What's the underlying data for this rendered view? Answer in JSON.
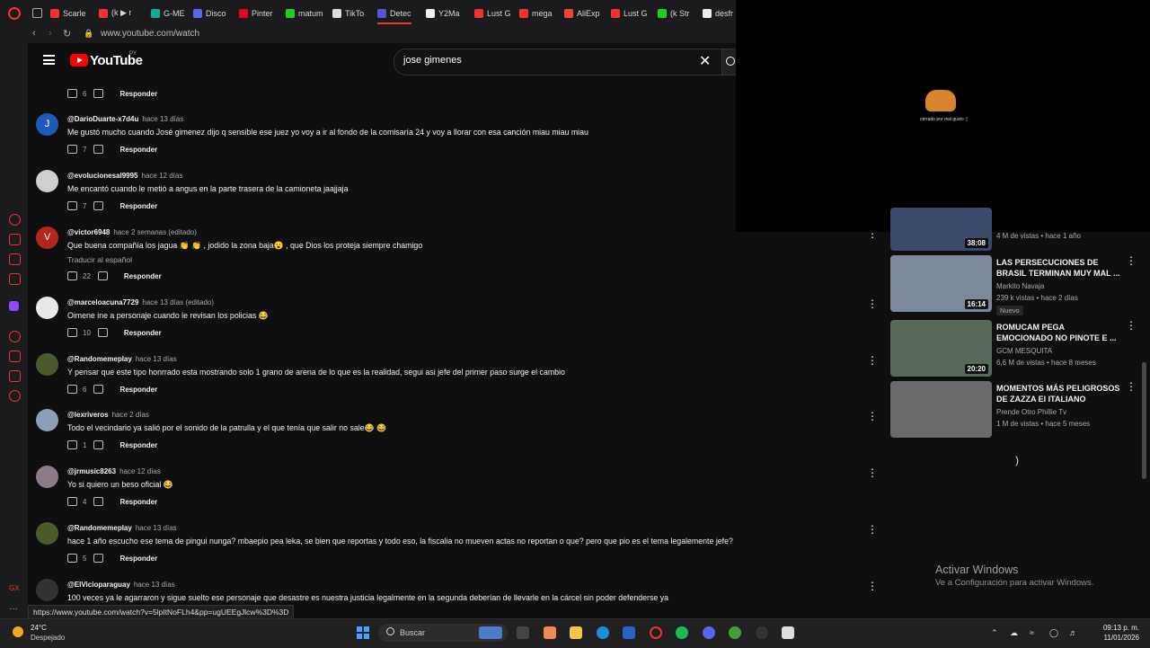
{
  "browser": {
    "tabs": [
      {
        "label": "Scarle",
        "color": "#e33"
      },
      {
        "label": "(k ▶ r",
        "color": "#e33"
      },
      {
        "label": "G-ME",
        "color": "#1a9"
      },
      {
        "label": "Disco",
        "color": "#5865f2"
      },
      {
        "label": "Pinter",
        "color": "#e60023"
      },
      {
        "label": "matum",
        "color": "#2c2"
      },
      {
        "label": "TikTo",
        "color": "#ddd"
      },
      {
        "label": "Detec",
        "color": "#55c"
      },
      {
        "label": "Y2Ma",
        "color": "#eee"
      },
      {
        "label": "Lust G",
        "color": "#e33"
      },
      {
        "label": "mega",
        "color": "#e33"
      },
      {
        "label": "AliExp",
        "color": "#e43"
      },
      {
        "label": "Lust G",
        "color": "#e33"
      },
      {
        "label": "(k Str",
        "color": "#2c2"
      },
      {
        "label": "desfr",
        "color": "#eee"
      }
    ],
    "url": "www.youtube.com/watch",
    "status_url": "https://www.youtube.com/watch?v=5lpItNoFLh4&pp=ugUEEgJlcw%3D%3D"
  },
  "header": {
    "logo_text": "YouTube",
    "region": "PY",
    "search_value": "jose gimenes"
  },
  "comments": [
    {
      "handle": "",
      "time": "",
      "text": "",
      "likes": "6",
      "reply": "Responder",
      "avatar_color": "#555",
      "avatar_letter": ""
    },
    {
      "handle": "@DarioDuarte-x7d4u",
      "time": "hace 13 días",
      "text": "Me gustó mucho cuando José gimenez dijo q sensible ese juez yo voy a ir al fondo de la comisaría 24 y voy a llorar con esa canción miau miau miau",
      "likes": "7",
      "reply": "Responder",
      "avatar_color": "#1e5bb8",
      "avatar_letter": "J"
    },
    {
      "handle": "@evolucionesal9995",
      "time": "hace 12 días",
      "text": "Me encantó cuando le metió a angus en la parte trasera de la camioneta jaajjaja",
      "likes": "7",
      "reply": "Responder",
      "avatar_color": "#cfcfcf",
      "avatar_letter": ""
    },
    {
      "handle": "@victor6948",
      "time": "hace 2 semanas (editado)",
      "text": "Que buena compañía los jagua 👏 👏 , jodido la zona baja😮 , que Dios los proteja siempre chamigo",
      "translate": "Traducir al español",
      "likes": "22",
      "reply": "Responder",
      "avatar_color": "#b3261e",
      "avatar_letter": "V"
    },
    {
      "handle": "@marceloacuna7729",
      "time": "hace 13 días (editado)",
      "text": "Oimene ine a personaje cuando le revisan los policias 😂",
      "likes": "10",
      "reply": "Responder",
      "avatar_color": "#e8e8e8",
      "avatar_letter": ""
    },
    {
      "handle": "@Randomemeplay",
      "time": "hace 13 días",
      "text": "Y pensar que este tipo honrrado esta mostrando solo 1 grano de arena de lo que es la realidad, segui asi jefe del primer paso surge el cambio",
      "likes": "6",
      "reply": "Responder",
      "avatar_color": "#4a5a2a",
      "avatar_letter": ""
    },
    {
      "handle": "@lexriveros",
      "time": "hace 2 días",
      "text": "Todo el vecindario ya salió por el sonido de la patrulla y el que tenía que salir no sale😂 😂",
      "likes": "1",
      "reply": "Responder",
      "avatar_color": "#8aa0b8",
      "avatar_letter": ""
    },
    {
      "handle": "@jrmusic8263",
      "time": "hace 12 días",
      "text": "Yo si quiero un beso oficial 😂",
      "likes": "4",
      "reply": "Responder",
      "avatar_color": "#8a7a8a",
      "avatar_letter": ""
    },
    {
      "handle": "@Randomemeplay",
      "time": "hace 13 días",
      "text": "hace 1 año escucho ese tema de pingui nunga? mbaepio pea leka, se bien que reportas y todo eso, la fiscalia no mueven actas no reportan o que? pero que pio es el tema legalemente jefe?",
      "likes": "5",
      "reply": "Responder",
      "avatar_color": "#4a5a2a",
      "avatar_letter": ""
    },
    {
      "handle": "@ElVicioparaguay",
      "time": "hace 13 días",
      "text": "100 veces ya le agarraron y sigue suelto ese personaje que desastre es nuestra justicia legalmente en la segunda deberían de llevarle en la cárcel sin poder defenderse ya",
      "likes": "",
      "reply": "",
      "avatar_color": "#333",
      "avatar_letter": ""
    }
  ],
  "overlay": {
    "caption": "cerrado por mal gusto :("
  },
  "suggested": [
    {
      "title": "",
      "channel": "",
      "meta": "4 M de vistas • hace 1 año",
      "duration": "38:08",
      "badge": "",
      "thumb_color": "#3a4a6a"
    },
    {
      "title": "LAS PERSECUCIONES DE BRASIL TERMINAN MUY MAL ...",
      "channel": "Markito Navaja",
      "meta": "239 k vistas • hace 2 días",
      "duration": "16:14",
      "badge": "Nuevo",
      "thumb_color": "#7a8a9a"
    },
    {
      "title": "ROMUCAM PEGA EMOCIONADO NO PINOTE E ...",
      "channel": "GCM MESQUITA",
      "meta": "6,6 M de vistas • hace 8 meses",
      "duration": "20:20",
      "badge": "",
      "thumb_color": "#5a6a5a"
    },
    {
      "title": "MOMENTOS MÁS PELIGROSOS DE ZAZZA El ITALIANO",
      "channel": "Prende Otro Phillie Tv",
      "meta": "1 M de vistas • hace 5 meses",
      "duration": "",
      "badge": "",
      "thumb_color": "#6a6a6a"
    }
  ],
  "watermark": {
    "title": "Activar Windows",
    "subtitle": "Ve a Configuración para activar Windows."
  },
  "taskbar": {
    "temp": "24°C",
    "weather": "Despejado",
    "search_label": "Buscar",
    "time": "09:13 p. m.",
    "date": "11/01/2026"
  }
}
